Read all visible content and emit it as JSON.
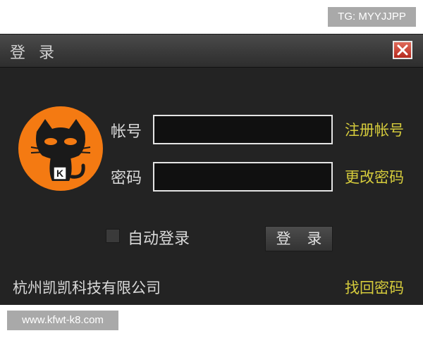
{
  "watermarks": {
    "top": "TG: MYYJJPP",
    "bottom": "www.kfwt-k8.com"
  },
  "dialog": {
    "title": "登 录",
    "close_icon": "close-icon"
  },
  "form": {
    "account_label": "帐号",
    "account_value": "",
    "password_label": "密码",
    "password_value": ""
  },
  "links": {
    "register": "注册帐号",
    "change_password": "更改密码",
    "recover_password": "找回密码"
  },
  "auto_login": {
    "label": "自动登录",
    "checked": false
  },
  "login_button": "登 录",
  "footer": {
    "company": "杭州凯凯科技有限公司"
  },
  "colors": {
    "background": "#232323",
    "link": "#d6cc3c",
    "avatar_orange": "#f47a12"
  }
}
